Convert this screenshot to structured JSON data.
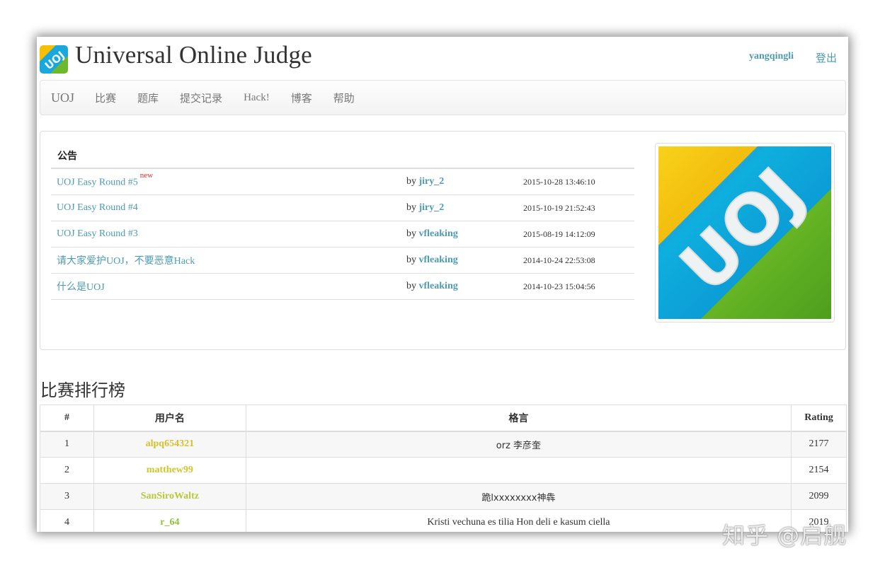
{
  "header": {
    "logo_text": "UOJ",
    "site_title": "Universal Online Judge",
    "username": "yangqingli",
    "logout": "登出"
  },
  "navbar": {
    "brand": "UOJ",
    "items": [
      "比赛",
      "题库",
      "提交记录",
      "Hack!",
      "博客",
      "帮助"
    ]
  },
  "announcements": {
    "title": "公告",
    "rows": [
      {
        "title": "UOJ Easy Round #5",
        "new_badge": "new",
        "by": "by",
        "author": "jiry_2",
        "time": "2015-10-28 13:46:10"
      },
      {
        "title": "UOJ Easy Round #4",
        "new_badge": "",
        "by": "by",
        "author": "jiry_2",
        "time": "2015-10-19 21:52:43"
      },
      {
        "title": "UOJ Easy Round #3",
        "new_badge": "",
        "by": "by",
        "author": "vfleaking",
        "time": "2015-08-19 14:12:09"
      },
      {
        "title": "请大家爱护UOJ，不要恶意Hack",
        "new_badge": "",
        "by": "by",
        "author": "vfleaking",
        "time": "2014-10-24 22:53:08"
      },
      {
        "title": "什么是UOJ",
        "new_badge": "",
        "by": "by",
        "author": "vfleaking",
        "time": "2014-10-23 15:04:56"
      }
    ]
  },
  "promo_image": {
    "text": "UOJ"
  },
  "ranking": {
    "title": "比赛排行榜",
    "columns": [
      "#",
      "用户名",
      "格言",
      "Rating"
    ],
    "rows": [
      {
        "rank": "1",
        "user": "alpq654321",
        "motto": "orz 李彦奎",
        "rating": "2177",
        "color": "#d6c12b"
      },
      {
        "rank": "2",
        "user": "matthew99",
        "motto": "",
        "rating": "2154",
        "color": "#cfc52d"
      },
      {
        "rank": "3",
        "user": "SanSiroWaltz",
        "motto": "跪lxxxxxxxx神犇",
        "rating": "2099",
        "color": "#b8c83a"
      },
      {
        "rank": "4",
        "user": "r_64",
        "motto": "Kristi vechuna es tilia Hon deli e kasum ciella",
        "rating": "2019",
        "color": "#8fc43d"
      }
    ]
  },
  "watermark": "知乎 @启舰",
  "colors": {
    "link": "#4e9bb0",
    "new_badge": "#d9302c"
  }
}
